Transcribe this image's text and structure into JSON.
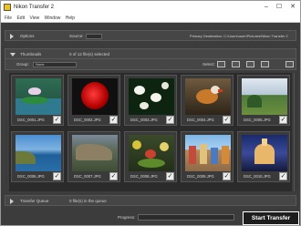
{
  "window": {
    "title": "Nikon Transfer 2",
    "minimize": "–",
    "maximize": "☐",
    "close": "✕"
  },
  "menu": [
    "File",
    "Edit",
    "View",
    "Window",
    "Help"
  ],
  "options": {
    "label": "Options",
    "source_label": "Source:",
    "destination_text": "Primary Destination: C:\\Users\\user\\Pictures\\Nikon Transfer 2"
  },
  "thumbnails": {
    "label": "Thumbnails",
    "selection_text": "0 of 12 file(s) selected",
    "group_label": "Group:",
    "group_value": "None",
    "select_label": "Select:"
  },
  "items": [
    {
      "name": "DSC_0001.JPG",
      "checked": true,
      "scene": "lily"
    },
    {
      "name": "DSC_0002.JPG",
      "checked": true,
      "scene": "rose"
    },
    {
      "name": "DSC_0003.JPG",
      "checked": true,
      "scene": "flowers"
    },
    {
      "name": "DSC_0004.JPG",
      "checked": true,
      "scene": "duck"
    },
    {
      "name": "DSC_0005.JPG",
      "checked": true,
      "scene": "landscape"
    },
    {
      "name": "DSC_0006.JPG",
      "checked": true,
      "scene": "coast"
    },
    {
      "name": "DSC_0007.JPG",
      "checked": true,
      "scene": "cliffs"
    },
    {
      "name": "DSC_0008.JPG",
      "checked": true,
      "scene": "garden"
    },
    {
      "name": "DSC_0009.JPG",
      "checked": true,
      "scene": "street"
    },
    {
      "name": "DSC_0010.JPG",
      "checked": true,
      "scene": "night"
    }
  ],
  "queue": {
    "label": "Transfer Queue",
    "count_text": "0 file(s) in the queue",
    "progress_label": "Progress:",
    "start_label": "Start Transfer"
  }
}
